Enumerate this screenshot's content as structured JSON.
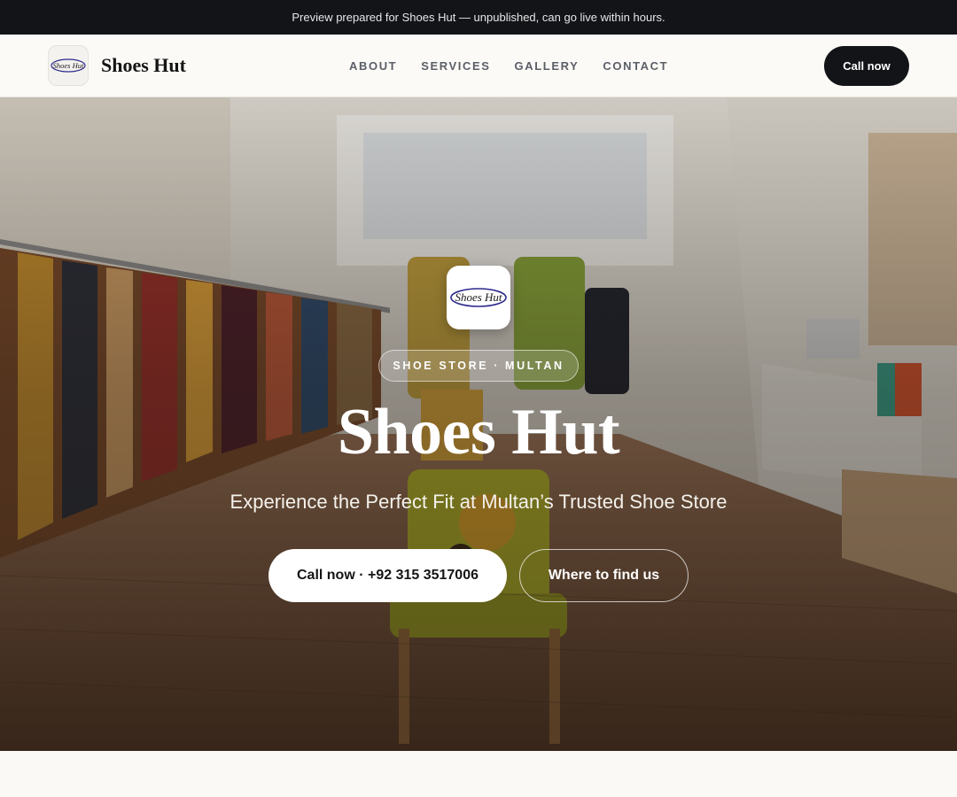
{
  "banner": {
    "text": "Preview prepared for Shoes Hut — unpublished, can go live within hours."
  },
  "header": {
    "brand": "Shoes Hut",
    "logo_text": "Shoes Hut",
    "nav": [
      "ABOUT",
      "SERVICES",
      "GALLERY",
      "CONTACT"
    ],
    "call_label": "Call now"
  },
  "hero": {
    "logo_text": "Shoes Hut",
    "tag": "SHOE STORE · MULTAN",
    "title": "Shoes Hut",
    "subtitle": "Experience the Perfect Fit at Multan’s Trusted Shoe Store",
    "primary_button": "Call now · +92 315 3517006",
    "secondary_button": "Where to find us"
  },
  "colors": {
    "dark": "#121418",
    "accent_white": "#ffffff",
    "logo_ink": "#2c2a8c"
  }
}
